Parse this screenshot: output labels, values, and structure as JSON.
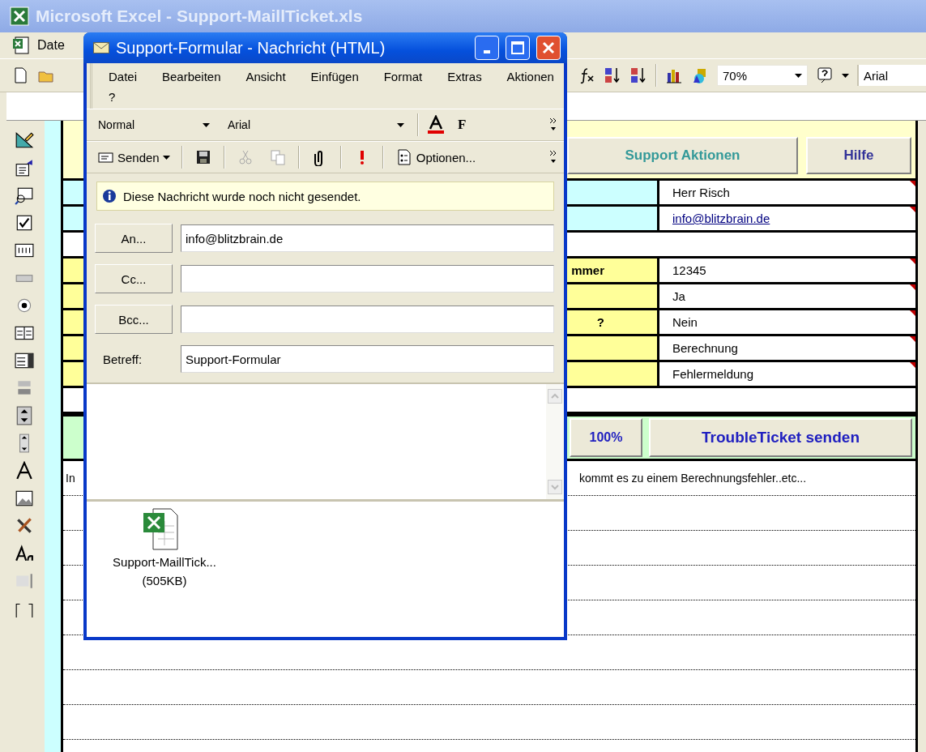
{
  "excel": {
    "title": "Microsoft Excel - Support-MaillTicket.xls",
    "menu": [
      "Date"
    ],
    "toolbar": {
      "zoom": "70%",
      "font": "Arial"
    },
    "sheet": {
      "actions": [
        {
          "label": "Support Aktionen",
          "color": "#339999"
        },
        {
          "label": "Hilfe",
          "color": "#333399"
        }
      ],
      "rows": [
        {
          "kind": "field",
          "value": "Herr Risch",
          "color": "#ccffff",
          "link": false
        },
        {
          "kind": "field",
          "value": "info@blitzbrain.de",
          "color": "#ccffff",
          "link": true
        },
        {
          "kind": "blank"
        },
        {
          "kind": "field",
          "label": "mmer",
          "value": "12345",
          "color": "#ffff99",
          "link": false
        },
        {
          "kind": "field",
          "value": "Ja",
          "color": "#ffff99",
          "link": false
        },
        {
          "kind": "field",
          "label": "?",
          "value": "Nein",
          "color": "#ffff99",
          "link": false
        },
        {
          "kind": "field",
          "value": "Berechnung",
          "color": "#ffff99",
          "link": false
        },
        {
          "kind": "field",
          "value": "Fehlermeldung",
          "color": "#ffff99",
          "link": false
        },
        {
          "kind": "blank"
        }
      ],
      "buttons": [
        "100%",
        "TroubleTicket senden"
      ],
      "notes": {
        "start": "In",
        "end": "kommt es zu einem Berechnungsfehler..etc..."
      }
    }
  },
  "message": {
    "title": "Support-Formular - Nachricht (HTML)",
    "menu": [
      [
        "Datei",
        "Bearbeiten",
        "Ansicht",
        "Einfügen",
        "Format",
        "Extras",
        "Aktionen"
      ],
      [
        "?"
      ]
    ],
    "format_bar": {
      "style": "Normal",
      "font": "Arial",
      "bold": "F"
    },
    "toolbar": [
      {
        "kind": "send",
        "label": "Senden",
        "disabled": false
      },
      {
        "kind": "save",
        "disabled": false
      },
      {
        "kind": "cut",
        "disabled": true
      },
      {
        "kind": "copy",
        "disabled": true
      },
      {
        "kind": "attach",
        "disabled": false
      },
      {
        "kind": "importance",
        "disabled": false
      },
      {
        "kind": "options",
        "label": "Optionen...",
        "disabled": false
      }
    ],
    "info": "Diese Nachricht wurde noch nicht gesendet.",
    "fields": [
      {
        "kind": "button",
        "label": "An...",
        "value": "info@blitzbrain.de"
      },
      {
        "kind": "button",
        "label": "Cc..."
      },
      {
        "kind": "button",
        "label": "Bcc..."
      },
      {
        "kind": "text",
        "label": "Betreff:",
        "value": "Support-Formular"
      }
    ],
    "attachment": {
      "name": "Support-MaillTick...",
      "size": "(505KB)"
    }
  }
}
